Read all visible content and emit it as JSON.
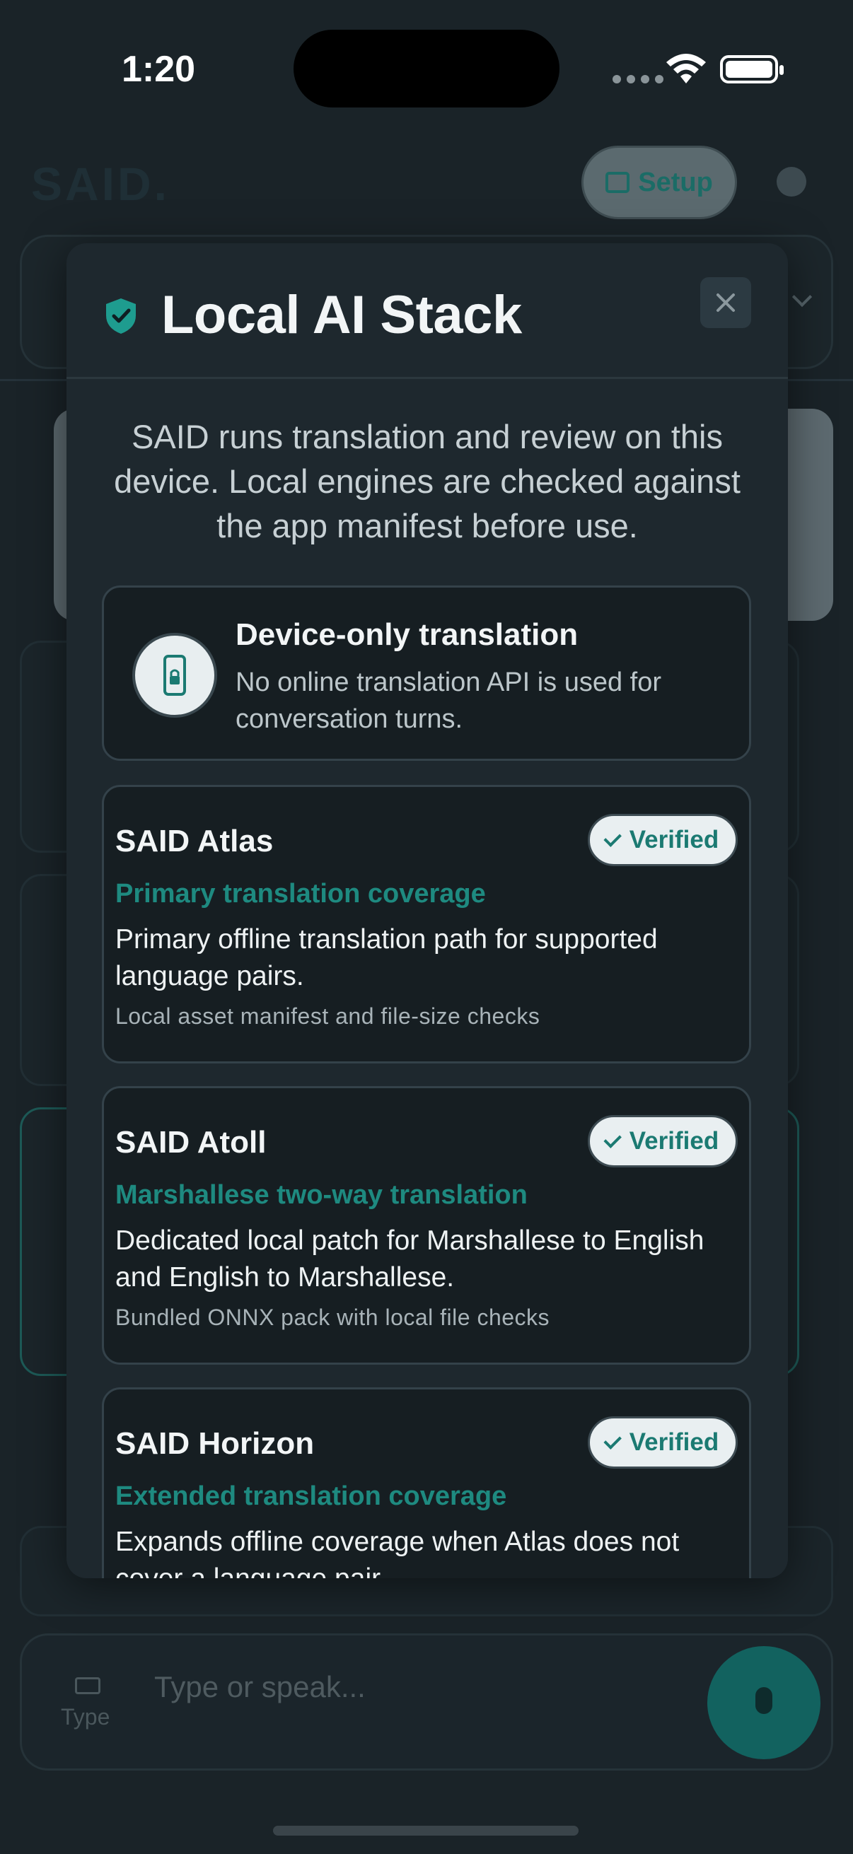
{
  "status_bar": {
    "time": "1:20"
  },
  "background": {
    "logo": "SAID.",
    "setup_label": "Setup",
    "type_label": "Type",
    "input_placeholder": "Type or speak..."
  },
  "modal": {
    "title": "Local AI Stack",
    "intro": "SAID runs translation and review on this device. Local engines are checked against the app manifest before use.",
    "device_card": {
      "title": "Device-only translation",
      "description": "No online translation API is used for conversation turns."
    },
    "engines": [
      {
        "name": "SAID Atlas",
        "status": "Verified",
        "tag": "Primary translation coverage",
        "description": "Primary offline translation path for supported language pairs.",
        "note": "Local asset manifest and file-size checks"
      },
      {
        "name": "SAID Atoll",
        "status": "Verified",
        "tag": "Marshallese two-way translation",
        "description": "Dedicated local patch for Marshallese to English and English to Marshallese.",
        "note": "Bundled ONNX pack with local file checks"
      },
      {
        "name": "SAID Horizon",
        "status": "Verified",
        "tag": "Extended translation coverage",
        "description": "Expands offline coverage when Atlas does not cover a language pair.",
        "note": ""
      }
    ]
  },
  "colors": {
    "accent": "#1e8a80",
    "modal_bg": "#1e282e",
    "card_bg": "#161e22",
    "page_bg": "#1a2328"
  }
}
